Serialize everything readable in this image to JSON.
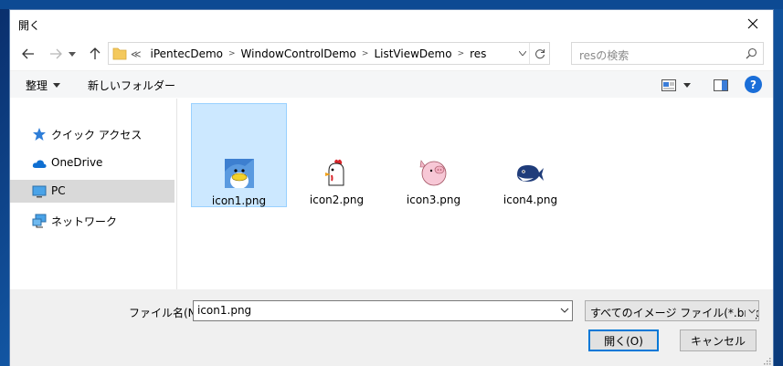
{
  "window": {
    "title": "開く"
  },
  "address": {
    "lead": "≪",
    "crumbs": [
      "iPentecDemo",
      "WindowControlDemo",
      "ListViewDemo",
      "res"
    ],
    "search_placeholder": "resの検索"
  },
  "toolbar": {
    "organize": "整理",
    "new_folder": "新しいフォルダー"
  },
  "nav": {
    "items": [
      {
        "label": "クイック アクセス",
        "icon": "star-icon"
      },
      {
        "label": "OneDrive",
        "icon": "cloud-icon"
      },
      {
        "label": "PC",
        "icon": "monitor-icon",
        "selected": true
      },
      {
        "label": "ネットワーク",
        "icon": "network-icon"
      }
    ]
  },
  "files": [
    {
      "name": "icon1.png",
      "icon": "penguin-icon",
      "selected": true
    },
    {
      "name": "icon2.png",
      "icon": "chicken-icon"
    },
    {
      "name": "icon3.png",
      "icon": "pig-icon"
    },
    {
      "name": "icon4.png",
      "icon": "whale-icon"
    }
  ],
  "footer": {
    "filename_label": "ファイル名(N):",
    "filename_value": "icon1.png",
    "filter_value": "すべてのイメージ ファイル(*.bmp,*.g",
    "open_button": "開く(O)",
    "cancel_button": "キャンセル"
  },
  "colors": {
    "selection": "#cce8ff",
    "accent": "#0078d7",
    "help": "#1a6ed8"
  }
}
